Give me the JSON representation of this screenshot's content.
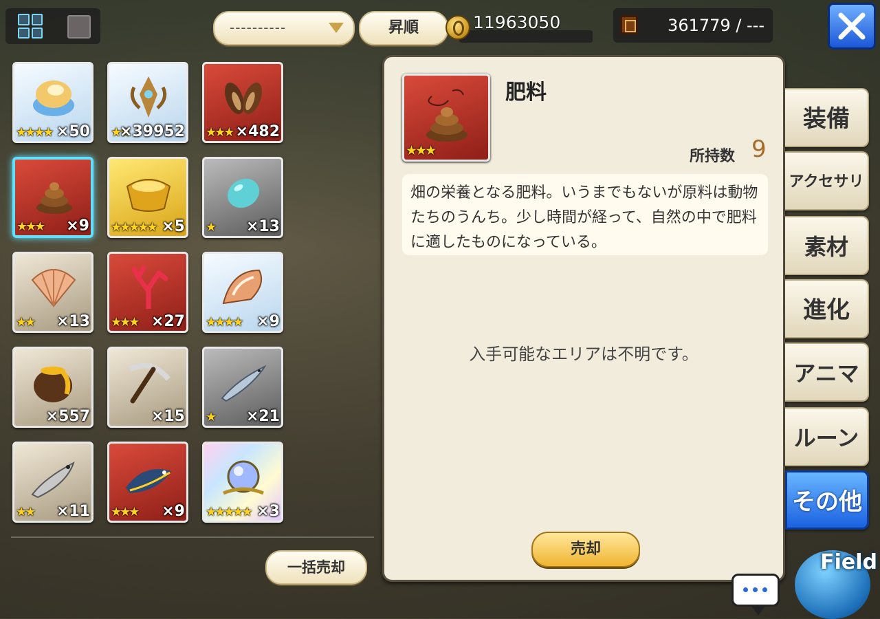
{
  "header": {
    "sort_dropdown": "----------",
    "order_button": "昇順",
    "gold": "11963050",
    "inventory": "361779 / ---"
  },
  "items": [
    {
      "stars": "★★★★",
      "count": "×50",
      "rarity": "blue",
      "icon": "cream-puff-icon"
    },
    {
      "stars": "★★",
      "count": "×39952",
      "rarity": "blue",
      "icon": "ornament-icon"
    },
    {
      "stars": "★★★",
      "count": "×482",
      "rarity": "red",
      "icon": "seeds-icon"
    },
    {
      "stars": "★★★",
      "count": "×9",
      "rarity": "red",
      "icon": "fertilizer-icon",
      "selected": true
    },
    {
      "stars": "★★★★★",
      "count": "×5",
      "rarity": "gold",
      "icon": "gold-ingot-icon"
    },
    {
      "stars": "★",
      "count": "×13",
      "rarity": "gray",
      "icon": "blue-gem-icon"
    },
    {
      "stars": "★★",
      "count": "×13",
      "rarity": "tan",
      "icon": "scallop-shell-icon"
    },
    {
      "stars": "★★★",
      "count": "×27",
      "rarity": "red",
      "icon": "coral-icon"
    },
    {
      "stars": "★★★★",
      "count": "×9",
      "rarity": "blue",
      "icon": "conch-shell-icon"
    },
    {
      "stars": "",
      "count": "×557",
      "rarity": "tan",
      "icon": "honey-pot-icon"
    },
    {
      "stars": "",
      "count": "×15",
      "rarity": "tan",
      "icon": "pickaxe-icon"
    },
    {
      "stars": "★",
      "count": "×21",
      "rarity": "gray",
      "icon": "sardine-icon"
    },
    {
      "stars": "★★",
      "count": "×11",
      "rarity": "tan",
      "icon": "fish-icon"
    },
    {
      "stars": "★★★",
      "count": "×9",
      "rarity": "red",
      "icon": "tuna-icon"
    },
    {
      "stars": "★★★★★",
      "count": "×3",
      "rarity": "rainbow",
      "icon": "crystal-orb-icon"
    }
  ],
  "bulk_sell": "一括売却",
  "detail": {
    "name": "肥料",
    "stars": "★★★",
    "owned_label": "所持数",
    "owned_value": "9",
    "description": "畑の栄養となる肥料。いうまでもないが原料は動物たちのうんち。少し時間が経って、自然の中で肥料に適したものになっている。",
    "area_text": "入手可能なエリアは不明です。",
    "sell_button": "売却"
  },
  "tabs": [
    "装備",
    "アクセサリ",
    "素材",
    "進化",
    "アニマ",
    "ルーン",
    "その他"
  ],
  "field_label": "Field",
  "colors": {
    "accent_blue": "#1b62e0",
    "star": "#ffd21f",
    "owned": "#a86c2a"
  }
}
